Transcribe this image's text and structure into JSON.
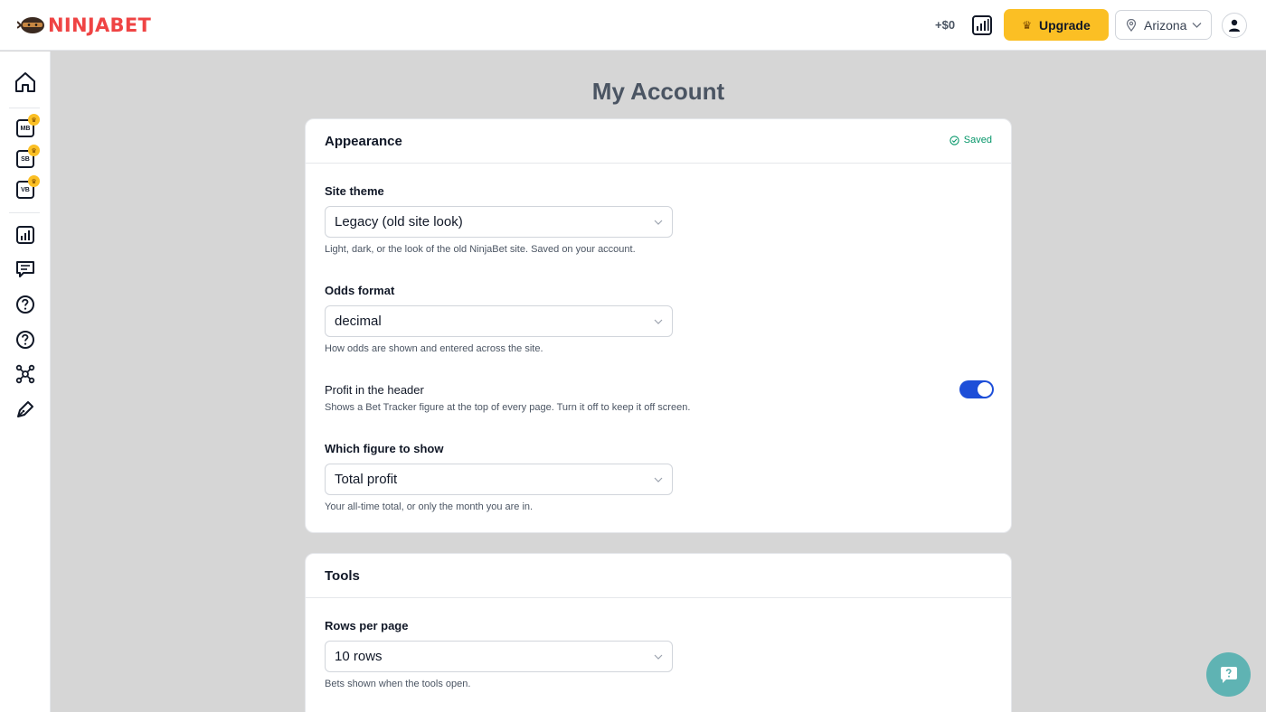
{
  "header": {
    "logo_text": "NINJABET",
    "profit": "+$0",
    "upgrade_label": "Upgrade",
    "region": "Arizona"
  },
  "sidebar": {
    "items": [
      {
        "name": "home"
      },
      {
        "name": "mb",
        "label": "MB"
      },
      {
        "name": "sb",
        "label": "SB"
      },
      {
        "name": "vb",
        "label": "VB"
      },
      {
        "name": "bet-tracker"
      },
      {
        "name": "feedback"
      },
      {
        "name": "help"
      },
      {
        "name": "faq"
      },
      {
        "name": "network"
      },
      {
        "name": "pen"
      }
    ]
  },
  "page": {
    "title": "My Account"
  },
  "appearance": {
    "heading": "Appearance",
    "status": "Saved",
    "site_theme": {
      "label": "Site theme",
      "value": "Legacy (old site look)",
      "hint": "Light, dark, or the look of the old NinjaBet site. Saved on your account."
    },
    "odds_format": {
      "label": "Odds format",
      "value": "decimal",
      "hint": "How odds are shown and entered across the site."
    },
    "profit_header": {
      "label": "Profit in the header",
      "hint": "Shows a Bet Tracker figure at the top of every page. Turn it off to keep it off screen.",
      "enabled": true
    },
    "figure": {
      "label": "Which figure to show",
      "value": "Total profit",
      "hint": "Your all-time total, or only the month you are in."
    }
  },
  "tools": {
    "heading": "Tools",
    "rows_per_page": {
      "label": "Rows per page",
      "value": "10 rows",
      "hint": "Bets shown when the tools open."
    }
  },
  "colors": {
    "brand": "#ef4444",
    "accent": "#fbbf24",
    "toggle_on": "#1d4ed8",
    "saved": "#059669",
    "chat": "#5fb3b3"
  }
}
